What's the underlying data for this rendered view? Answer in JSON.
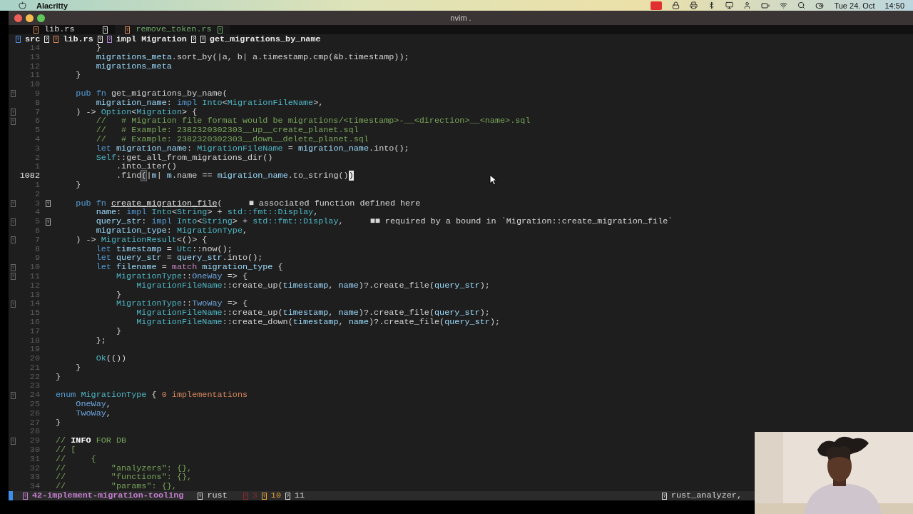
{
  "menu_bar": {
    "app_name": "Alacritty",
    "date": "Tue 24. Oct",
    "time": "14:50"
  },
  "window": {
    "title": "nvim ."
  },
  "tabs": [
    {
      "label": "lib.rs",
      "selected": true
    },
    {
      "label": "remove_token.rs",
      "selected": false
    }
  ],
  "winbar": [
    {
      "label": "src",
      "color": "#4f8fe0"
    },
    {
      "label": "lib.rs",
      "color": "#d9895a"
    },
    {
      "label": "impl Migration",
      "color": "#b38ad6"
    },
    {
      "label": "get_migrations_by_name",
      "color": "#d8d8d8"
    }
  ],
  "lines": [
    {
      "number": "14",
      "current": false,
      "sign": false,
      "marker": false,
      "tokens": [
        {
          "kind": "plain",
          "text": "        }"
        }
      ]
    },
    {
      "number": "13",
      "current": false,
      "sign": false,
      "marker": false,
      "tokens": [
        {
          "kind": "var",
          "text": "        migrations_meta"
        },
        {
          "kind": "plain",
          "text": ".sort_by(|a, b| a.timestamp.cmp(&b.timestamp));"
        }
      ]
    },
    {
      "number": "12",
      "current": false,
      "sign": false,
      "marker": false,
      "tokens": [
        {
          "kind": "var",
          "text": "        migrations_meta"
        }
      ]
    },
    {
      "number": "11",
      "current": false,
      "sign": false,
      "marker": false,
      "tokens": [
        {
          "kind": "plain",
          "text": "    }"
        }
      ]
    },
    {
      "number": "10",
      "current": false,
      "sign": false,
      "marker": false
    },
    {
      "number": "9",
      "current": false,
      "sign": true,
      "marker": false,
      "tokens": [
        {
          "kind": "keyword",
          "text": "    pub fn "
        },
        {
          "kind": "plain",
          "text": "get_migrations_by_name("
        }
      ]
    },
    {
      "number": "8",
      "current": false,
      "sign": false,
      "marker": false,
      "tokens": [
        {
          "kind": "var",
          "text": "        migration_name"
        },
        {
          "kind": "plain",
          "text": ": "
        },
        {
          "kind": "keyword",
          "text": "impl "
        },
        {
          "kind": "type",
          "text": "Into"
        },
        {
          "kind": "plain",
          "text": "<"
        },
        {
          "kind": "type",
          "text": "MigrationFileName"
        },
        {
          "kind": "plain",
          "text": ">,"
        }
      ]
    },
    {
      "number": "7",
      "current": false,
      "sign": true,
      "marker": false,
      "tokens": [
        {
          "kind": "plain",
          "text": "    ) -> "
        },
        {
          "kind": "type",
          "text": "Option"
        },
        {
          "kind": "plain",
          "text": "<"
        },
        {
          "kind": "type",
          "text": "Migration"
        },
        {
          "kind": "plain",
          "text": "> {"
        }
      ]
    },
    {
      "number": "6",
      "current": false,
      "sign": true,
      "marker": false,
      "tokens": [
        {
          "kind": "comment",
          "text": "        //   # Migration file format would be migrations/<timestamp>-__<direction>__<name>.sql"
        }
      ]
    },
    {
      "number": "5",
      "current": false,
      "sign": false,
      "marker": false,
      "tokens": [
        {
          "kind": "comment",
          "text": "        //   # Example: 2382320302303__up__create_planet.sql"
        }
      ]
    },
    {
      "number": "4",
      "current": false,
      "sign": false,
      "marker": false,
      "tokens": [
        {
          "kind": "comment",
          "text": "        //   # Example: 2382320302303__down__delete_planet.sql"
        }
      ]
    },
    {
      "number": "3",
      "current": false,
      "sign": false,
      "marker": false,
      "tokens": [
        {
          "kind": "keyword",
          "text": "        let "
        },
        {
          "kind": "var",
          "text": "migration_name"
        },
        {
          "kind": "plain",
          "text": ": "
        },
        {
          "kind": "type",
          "text": "MigrationFileName"
        },
        {
          "kind": "plain",
          "text": " = "
        },
        {
          "kind": "var",
          "text": "migration_name"
        },
        {
          "kind": "plain",
          "text": ".into();"
        }
      ]
    },
    {
      "number": "2",
      "current": false,
      "sign": false,
      "marker": false,
      "tokens": [
        {
          "kind": "type",
          "text": "        Self"
        },
        {
          "kind": "plain",
          "text": "::get_all_from_migrations_dir()"
        }
      ]
    },
    {
      "number": "1",
      "current": false,
      "sign": false,
      "marker": false,
      "tokens": [
        {
          "kind": "plain",
          "text": "            .into_iter()"
        }
      ]
    },
    {
      "number": "1082",
      "current": true,
      "sign": false,
      "marker": false,
      "tokens": [
        {
          "kind": "plain",
          "text": "            .find"
        },
        {
          "kind": "paren",
          "text": "("
        },
        {
          "kind": "plain",
          "text": "|"
        },
        {
          "kind": "var",
          "text": "m"
        },
        {
          "kind": "plain",
          "text": "| "
        },
        {
          "kind": "var",
          "text": "m"
        },
        {
          "kind": "plain",
          "text": ".name == "
        },
        {
          "kind": "var",
          "text": "migration_name"
        },
        {
          "kind": "plain",
          "text": ".to_string()"
        },
        {
          "kind": "cursor",
          "text": ")"
        }
      ]
    },
    {
      "number": "1",
      "current": false,
      "sign": false,
      "marker": false,
      "tokens": [
        {
          "kind": "plain",
          "text": "    }"
        }
      ]
    },
    {
      "number": "2",
      "current": false,
      "sign": false,
      "marker": false
    },
    {
      "number": "3",
      "current": false,
      "sign": true,
      "marker": true,
      "tokens": [
        {
          "kind": "keyword",
          "text": "    pub fn "
        },
        {
          "kind": "underlined",
          "text": "create_migration_file"
        },
        {
          "kind": "plain",
          "text": "("
        }
      ],
      "diagnostic": "■ associated function defined here"
    },
    {
      "number": "4",
      "current": false,
      "sign": false,
      "marker": false,
      "tokens": [
        {
          "kind": "var",
          "text": "        name"
        },
        {
          "kind": "plain",
          "text": ": "
        },
        {
          "kind": "keyword",
          "text": "impl "
        },
        {
          "kind": "type",
          "text": "Into"
        },
        {
          "kind": "plain",
          "text": "<"
        },
        {
          "kind": "type",
          "text": "String"
        },
        {
          "kind": "plain",
          "text": "> + "
        },
        {
          "kind": "type",
          "text": "std::fmt::Display"
        },
        {
          "kind": "plain",
          "text": ","
        }
      ]
    },
    {
      "number": "5",
      "current": false,
      "sign": true,
      "marker": true,
      "tokens": [
        {
          "kind": "var",
          "text": "        query_str"
        },
        {
          "kind": "plain",
          "text": ": "
        },
        {
          "kind": "keyword",
          "text": "impl "
        },
        {
          "kind": "type",
          "text": "Into"
        },
        {
          "kind": "plain",
          "text": "<"
        },
        {
          "kind": "type",
          "text": "String"
        },
        {
          "kind": "plain",
          "text": "> + "
        },
        {
          "kind": "type",
          "text": "std::fmt::Display"
        },
        {
          "kind": "plain",
          "text": ","
        }
      ],
      "diagnostic": "■■ required by a bound in `Migration::create_migration_file`"
    },
    {
      "number": "6",
      "current": false,
      "sign": false,
      "marker": false,
      "tokens": [
        {
          "kind": "var",
          "text": "        migration_type"
        },
        {
          "kind": "plain",
          "text": ": "
        },
        {
          "kind": "type",
          "text": "MigrationType"
        },
        {
          "kind": "plain",
          "text": ","
        }
      ]
    },
    {
      "number": "7",
      "current": false,
      "sign": true,
      "marker": false,
      "tokens": [
        {
          "kind": "plain",
          "text": "    ) -> "
        },
        {
          "kind": "type",
          "text": "MigrationResult"
        },
        {
          "kind": "plain",
          "text": "<()> {"
        }
      ]
    },
    {
      "number": "8",
      "current": false,
      "sign": false,
      "marker": false,
      "tokens": [
        {
          "kind": "keyword",
          "text": "        let "
        },
        {
          "kind": "var",
          "text": "timestamp"
        },
        {
          "kind": "plain",
          "text": " = "
        },
        {
          "kind": "type",
          "text": "Utc"
        },
        {
          "kind": "plain",
          "text": "::now();"
        }
      ]
    },
    {
      "number": "9",
      "current": false,
      "sign": false,
      "marker": false,
      "tokens": [
        {
          "kind": "keyword",
          "text": "        let "
        },
        {
          "kind": "var",
          "text": "query_str"
        },
        {
          "kind": "plain",
          "text": " = "
        },
        {
          "kind": "var",
          "text": "query_str"
        },
        {
          "kind": "plain",
          "text": ".into();"
        }
      ]
    },
    {
      "number": "10",
      "current": false,
      "sign": true,
      "marker": false,
      "tokens": [
        {
          "kind": "keyword",
          "text": "        let "
        },
        {
          "kind": "var",
          "text": "filename"
        },
        {
          "kind": "plain",
          "text": " = "
        },
        {
          "kind": "control",
          "text": "match "
        },
        {
          "kind": "var",
          "text": "migration_type"
        },
        {
          "kind": "plain",
          "text": " {"
        }
      ]
    },
    {
      "number": "11",
      "current": false,
      "sign": true,
      "marker": false,
      "tokens": [
        {
          "kind": "type",
          "text": "            MigrationType"
        },
        {
          "kind": "plain",
          "text": "::"
        },
        {
          "kind": "variant",
          "text": "OneWay"
        },
        {
          "kind": "plain",
          "text": " => {"
        }
      ]
    },
    {
      "number": "12",
      "current": false,
      "sign": false,
      "marker": false,
      "tokens": [
        {
          "kind": "type",
          "text": "                MigrationFileName"
        },
        {
          "kind": "plain",
          "text": "::create_up("
        },
        {
          "kind": "var",
          "text": "timestamp"
        },
        {
          "kind": "plain",
          "text": ", "
        },
        {
          "kind": "var",
          "text": "name"
        },
        {
          "kind": "plain",
          "text": ")?.create_file("
        },
        {
          "kind": "var",
          "text": "query_str"
        },
        {
          "kind": "plain",
          "text": ");"
        }
      ]
    },
    {
      "number": "13",
      "current": false,
      "sign": false,
      "marker": false,
      "tokens": [
        {
          "kind": "plain",
          "text": "            }"
        }
      ]
    },
    {
      "number": "14",
      "current": false,
      "sign": true,
      "marker": false,
      "tokens": [
        {
          "kind": "type",
          "text": "            MigrationType"
        },
        {
          "kind": "plain",
          "text": "::"
        },
        {
          "kind": "variant",
          "text": "TwoWay"
        },
        {
          "kind": "plain",
          "text": " => {"
        }
      ]
    },
    {
      "number": "15",
      "current": false,
      "sign": false,
      "marker": false,
      "tokens": [
        {
          "kind": "type",
          "text": "                MigrationFileName"
        },
        {
          "kind": "plain",
          "text": "::create_up("
        },
        {
          "kind": "var",
          "text": "timestamp"
        },
        {
          "kind": "plain",
          "text": ", "
        },
        {
          "kind": "var",
          "text": "name"
        },
        {
          "kind": "plain",
          "text": ")?.create_file("
        },
        {
          "kind": "var",
          "text": "query_str"
        },
        {
          "kind": "plain",
          "text": ");"
        }
      ]
    },
    {
      "number": "16",
      "current": false,
      "sign": false,
      "marker": false,
      "tokens": [
        {
          "kind": "type",
          "text": "                MigrationFileName"
        },
        {
          "kind": "plain",
          "text": "::create_down("
        },
        {
          "kind": "var",
          "text": "timestamp"
        },
        {
          "kind": "plain",
          "text": ", "
        },
        {
          "kind": "var",
          "text": "name"
        },
        {
          "kind": "plain",
          "text": ")?.create_file("
        },
        {
          "kind": "var",
          "text": "query_str"
        },
        {
          "kind": "plain",
          "text": ");"
        }
      ]
    },
    {
      "number": "17",
      "current": false,
      "sign": false,
      "marker": false,
      "tokens": [
        {
          "kind": "plain",
          "text": "            }"
        }
      ]
    },
    {
      "number": "18",
      "current": false,
      "sign": false,
      "marker": false,
      "tokens": [
        {
          "kind": "plain",
          "text": "        };"
        }
      ]
    },
    {
      "number": "19",
      "current": false,
      "sign": false,
      "marker": false
    },
    {
      "number": "20",
      "current": false,
      "sign": false,
      "marker": false,
      "tokens": [
        {
          "kind": "type",
          "text": "        Ok"
        },
        {
          "kind": "plain",
          "text": "(())"
        }
      ]
    },
    {
      "number": "21",
      "current": false,
      "sign": false,
      "marker": false,
      "tokens": [
        {
          "kind": "plain",
          "text": "    }"
        }
      ]
    },
    {
      "number": "22",
      "current": false,
      "sign": false,
      "marker": false,
      "tokens": [
        {
          "kind": "plain",
          "text": "}"
        }
      ]
    },
    {
      "number": "23",
      "current": false,
      "sign": false,
      "marker": false
    },
    {
      "number": "24",
      "current": false,
      "sign": true,
      "marker": false,
      "tokens": [
        {
          "kind": "keyword",
          "text": "enum "
        },
        {
          "kind": "type",
          "text": "MigrationType"
        },
        {
          "kind": "plain",
          "text": " {"
        }
      ],
      "inlay_hint": "0 implementations"
    },
    {
      "number": "25",
      "current": false,
      "sign": false,
      "marker": false,
      "tokens": [
        {
          "kind": "variant",
          "text": "    OneWay"
        },
        {
          "kind": "plain",
          "text": ","
        }
      ]
    },
    {
      "number": "26",
      "current": false,
      "sign": false,
      "marker": false,
      "tokens": [
        {
          "kind": "variant",
          "text": "    TwoWay"
        },
        {
          "kind": "plain",
          "text": ","
        }
      ]
    },
    {
      "number": "27",
      "current": false,
      "sign": false,
      "marker": false,
      "tokens": [
        {
          "kind": "plain",
          "text": "}"
        }
      ]
    },
    {
      "number": "28",
      "current": false,
      "sign": false,
      "marker": false
    },
    {
      "number": "29",
      "current": false,
      "sign": true,
      "marker": false,
      "tokens": [
        {
          "kind": "comment",
          "text": "// "
        },
        {
          "kind": "tag",
          "text": "INFO"
        },
        {
          "kind": "comment",
          "text": " FOR DB"
        }
      ]
    },
    {
      "number": "30",
      "current": false,
      "sign": false,
      "marker": false,
      "tokens": [
        {
          "kind": "comment",
          "text": "// ["
        }
      ]
    },
    {
      "number": "31",
      "current": false,
      "sign": false,
      "marker": false,
      "tokens": [
        {
          "kind": "comment",
          "text": "//     {"
        }
      ]
    },
    {
      "number": "32",
      "current": false,
      "sign": false,
      "marker": false,
      "tokens": [
        {
          "kind": "comment",
          "text": "//         \"analyzers\": {},"
        }
      ]
    },
    {
      "number": "33",
      "current": false,
      "sign": false,
      "marker": false,
      "tokens": [
        {
          "kind": "comment",
          "text": "//         \"functions\": {},"
        }
      ]
    },
    {
      "number": "34",
      "current": false,
      "sign": false,
      "marker": false,
      "tokens": [
        {
          "kind": "comment",
          "text": "//         \"params\": {},"
        }
      ]
    }
  ],
  "status_line": {
    "branch": "42-implement-migration-tooling",
    "language": "rust",
    "diagnostics": [
      {
        "count": "3",
        "color": "#8a2a2a"
      },
      {
        "count": "10",
        "color": "#e5a23a"
      },
      {
        "count": "11",
        "color": "#d8d8d8"
      }
    ],
    "lsp": "rust_analyzer,"
  }
}
